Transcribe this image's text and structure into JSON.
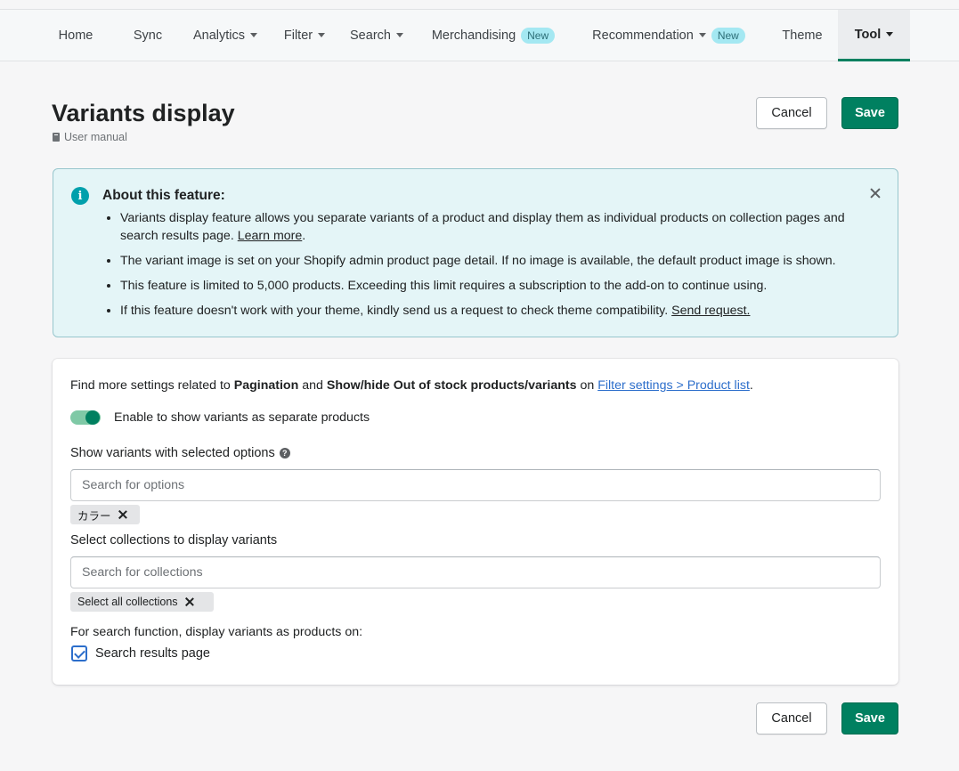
{
  "nav": {
    "items": [
      {
        "label": "Home"
      },
      {
        "label": "Sync"
      },
      {
        "label": "Analytics"
      },
      {
        "label": "Filter"
      },
      {
        "label": "Search"
      },
      {
        "label": "Merchandising",
        "badge": "New"
      },
      {
        "label": "Recommendation",
        "badge": "New"
      },
      {
        "label": "Theme"
      },
      {
        "label": "Tool"
      }
    ],
    "active": "Tool"
  },
  "page": {
    "title": "Variants display",
    "manual_link": "User manual",
    "cancel_label": "Cancel",
    "save_label": "Save"
  },
  "banner": {
    "title": "About this feature:",
    "b1_text": "Variants display feature allows you separate variants of a product and display them as individual products on collection pages and search results page.",
    "b1_link": "Learn more",
    "b2_text": "The variant image is set on your Shopify admin product page detail. If no image is available, the default product image is shown.",
    "b3_text": "This feature is limited to 5,000 products. Exceeding this limit requires a subscription to the add-on to continue using.",
    "b4_text": "If this feature doesn't work with your theme, kindly send us a request to check theme compatibility.",
    "b4_link": "Send request."
  },
  "settings": {
    "find_prefix": "Find more settings related to",
    "find_bold1": "Pagination",
    "find_and": "and",
    "find_bold2": "Show/hide Out of stock products/variants",
    "find_on": "on",
    "find_link": "Filter settings > Product list",
    "toggle_label": "Enable to show variants as separate products",
    "toggle_on": true,
    "options_label": "Show variants with selected options",
    "options_placeholder": "Search for options",
    "options_tag": "カラー",
    "collections_label": "Select collections to display variants",
    "collections_placeholder": "Search for collections",
    "collections_tag": "Select all collections",
    "search_fn_label": "For search function, display variants as products on:",
    "checkbox_label": "Search results page",
    "checkbox_checked": true
  },
  "colors": {
    "primary": "#008060",
    "banner_bg": "#e4f5f7",
    "link": "#2c6ecb"
  }
}
